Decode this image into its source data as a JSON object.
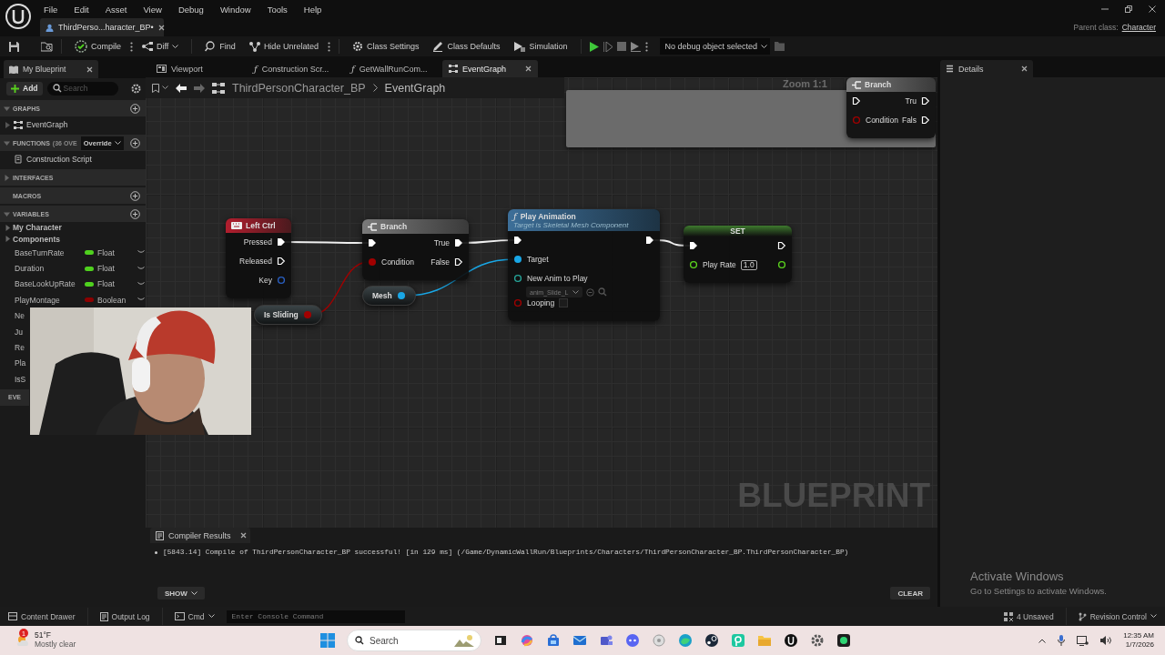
{
  "menu": [
    "File",
    "Edit",
    "Asset",
    "View",
    "Debug",
    "Window",
    "Tools",
    "Help"
  ],
  "document_tab": "ThirdPerso...haracter_BP•",
  "parent_class": {
    "label": "Parent class:",
    "value": "Character"
  },
  "toolbar": {
    "buttons": [
      {
        "label": "Compile",
        "kind": "kebab"
      },
      {
        "label": "Diff",
        "kind": "dropdown"
      },
      {
        "label": "Find",
        "kind": "plain"
      },
      {
        "label": "Hide Unrelated",
        "kind": "kebab"
      },
      {
        "label": "Class Settings",
        "kind": "plain"
      },
      {
        "label": "Class Defaults",
        "kind": "plain"
      },
      {
        "label": "Simulation",
        "kind": "plain"
      }
    ],
    "debug_object": "No debug object selected"
  },
  "sidebar": {
    "tab": "My Blueprint",
    "add": "Add",
    "search_placeholder": "Search",
    "sections": [
      {
        "title": "GRAPHS",
        "expanded": true,
        "addable": true,
        "items": [
          {
            "label": "EventGraph",
            "kind": "graph"
          }
        ]
      },
      {
        "title": "FUNCTIONS",
        "hint": "(36 OVE",
        "dropdown": "Override",
        "expanded": true,
        "addable": true,
        "items": [
          {
            "label": "Construction Script",
            "kind": "function"
          }
        ]
      },
      {
        "title": "INTERFACES",
        "expanded": false,
        "addable": false
      },
      {
        "title": "MACROS",
        "addable": true
      },
      {
        "title": "VARIABLES",
        "expanded": true,
        "addable": true,
        "categories": [
          {
            "label": "My Character",
            "expanded": false
          },
          {
            "label": "Components",
            "expanded": false
          }
        ],
        "items": [
          {
            "label": "BaseTurnRate",
            "kind": "variable",
            "type": "Float",
            "color": "#4fd11e"
          },
          {
            "label": "Duration",
            "kind": "variable",
            "type": "Float",
            "color": "#4fd11e"
          },
          {
            "label": "BaseLookUpRate",
            "kind": "variable",
            "type": "Float",
            "color": "#4fd11e"
          },
          {
            "label": "PlayMontage",
            "kind": "variable",
            "type": "Boolean",
            "color": "#8c0000"
          },
          {
            "label": "Ne",
            "kind": "variable"
          },
          {
            "label": "Ju",
            "kind": "variable"
          },
          {
            "label": "Re",
            "kind": "variable"
          },
          {
            "label": "Pla",
            "kind": "variable"
          },
          {
            "label": "IsS",
            "kind": "variable"
          }
        ]
      },
      {
        "title": "EVE",
        "addable": false
      }
    ]
  },
  "graph": {
    "tabs": [
      {
        "label": "Viewport",
        "kind": "viewport",
        "selected": false
      },
      {
        "label": "Construction Scr...",
        "kind": "function",
        "glyph": "ƒ",
        "selected": false
      },
      {
        "label": "GetWallRunCom...",
        "kind": "function",
        "glyph": "ƒ",
        "selected": false
      },
      {
        "label": "EventGraph",
        "kind": "graph",
        "selected": true
      }
    ],
    "breadcrumb": [
      "ThirdPersonCharacter_BP",
      "EventGraph"
    ],
    "nodes": [
      {
        "kind": "event",
        "title": "Left Ctrl",
        "outputs": [
          {
            "label": "Pressed",
            "kind": "exec",
            "connected": true
          },
          {
            "label": "Released",
            "kind": "exec",
            "connected": false
          },
          {
            "label": "Key",
            "kind": "struct",
            "connected": false
          }
        ]
      },
      {
        "kind": "flow",
        "title": "Branch",
        "inputs": [
          {
            "kind": "exec",
            "connected": true
          },
          {
            "label": "Condition",
            "kind": "bool",
            "connected": true
          }
        ],
        "outputs": [
          {
            "label": "True",
            "kind": "exec",
            "connected": true
          },
          {
            "label": "False",
            "kind": "exec",
            "connected": false
          }
        ]
      },
      {
        "kind": "function",
        "glyph": "ƒ",
        "title": "Play Animation",
        "subtitle": "Target is Skeletal Mesh Component",
        "inputs": [
          {
            "kind": "exec",
            "connected": true
          },
          {
            "label": "Target",
            "kind": "object",
            "connected": true
          },
          {
            "label": "New Anim to Play",
            "kind": "asset",
            "connected": false,
            "value": "anim_Slide_L"
          },
          {
            "label": "Looping",
            "kind": "bool",
            "connected": false,
            "checked": false
          }
        ],
        "outputs": [
          {
            "kind": "exec",
            "connected": true
          }
        ]
      },
      {
        "kind": "variable_set",
        "title": "SET",
        "inputs": [
          {
            "kind": "exec",
            "connected": true
          },
          {
            "label": "Play Rate",
            "kind": "float",
            "connected": false,
            "value": "1.0"
          }
        ],
        "outputs": [
          {
            "kind": "exec",
            "connected": false
          },
          {
            "kind": "float",
            "connected": false
          }
        ]
      },
      {
        "kind": "getter",
        "title": "Mesh",
        "outputs": [
          {
            "kind": "object",
            "connected": true
          }
        ]
      },
      {
        "kind": "getter",
        "title": "Is Sliding",
        "outputs": [
          {
            "kind": "bool",
            "connected": true
          }
        ]
      },
      {
        "kind": "flow",
        "title": "Branch",
        "inputs": [
          {
            "kind": "exec",
            "connected": false
          },
          {
            "label": "Condition",
            "kind": "bool",
            "connected": false
          }
        ],
        "outputs": [
          {
            "label": "Tru",
            "kind": "exec",
            "connected": false
          },
          {
            "label": "Fals",
            "kind": "exec",
            "connected": false
          }
        ]
      }
    ],
    "zoom_label": "Zoom 1:1",
    "watermark": "BLUEPRINT"
  },
  "compiler_results": {
    "tab": "Compiler Results",
    "messages": [
      "[5843.14] Compile of ThirdPersonCharacter_BP successful! [in 129 ms] (/Game/DynamicWallRun/Blueprints/Characters/ThirdPersonCharacter_BP.ThirdPersonCharacter_BP)"
    ],
    "show": "SHOW",
    "clear": "CLEAR"
  },
  "details": {
    "tab": "Details"
  },
  "activation_notice": {
    "title": "Activate Windows",
    "text": "Go to Settings to activate Windows."
  },
  "status_bar": {
    "content_drawer": "Content Drawer",
    "output_log": "Output Log",
    "cmd": "Cmd",
    "console_placeholder": "Enter Console Command",
    "unsaved": "4 Unsaved",
    "revision": "Revision Control"
  },
  "taskbar": {
    "weather": {
      "badge": "1",
      "temperature": "51°F",
      "condition": "Mostly clear"
    },
    "search_placeholder": "Search",
    "clock": {
      "time": "12:35 AM",
      "date": "1/7/2026"
    }
  }
}
